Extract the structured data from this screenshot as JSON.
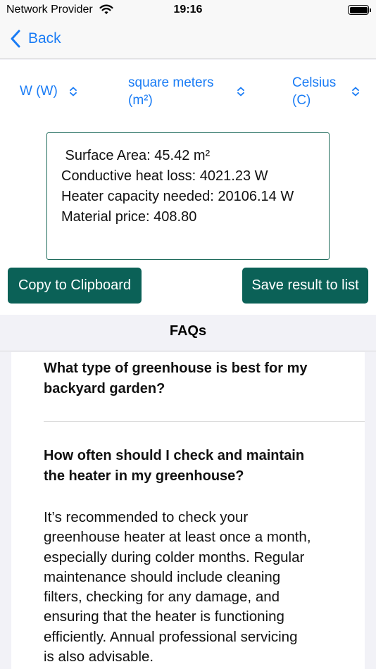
{
  "status_bar": {
    "carrier": "Network Provider",
    "time": "19:16"
  },
  "nav": {
    "back_label": "Back"
  },
  "units": {
    "power": {
      "line1": "W (W)",
      "line2": ""
    },
    "area": {
      "line1": "square meters",
      "line2": "(m²)"
    },
    "temperature": {
      "line1": "Celsius",
      "line2": "(C)"
    }
  },
  "result": {
    "lines": [
      " Surface Area: 45.42 m²",
      "Conductive heat loss: 4021.23 W",
      "Heater capacity needed: 20106.14 W",
      "Material price: 408.80"
    ]
  },
  "actions": {
    "copy_label": "Copy to Clipboard",
    "save_label": "Save result to list"
  },
  "faq": {
    "title": "FAQs",
    "items": [
      {
        "question_lines": [
          "What type of greenhouse is best for my",
          "backyard garden?"
        ]
      },
      {
        "question_lines": [
          "How often should I check and maintain",
          "the heater in my greenhouse?"
        ],
        "answer_lines": [
          "It’s recommended to check your",
          "greenhouse heater at least once a month,",
          "especially during colder months. Regular",
          "maintenance should include cleaning",
          "filters, checking for any damage, and",
          "ensuring that the heater is functioning",
          "efficiently. Annual professional servicing",
          "is also advisable."
        ]
      }
    ]
  },
  "colors": {
    "accent": "#1a7cf5",
    "button": "#0b6157",
    "result_border": "#1f6b5c"
  }
}
